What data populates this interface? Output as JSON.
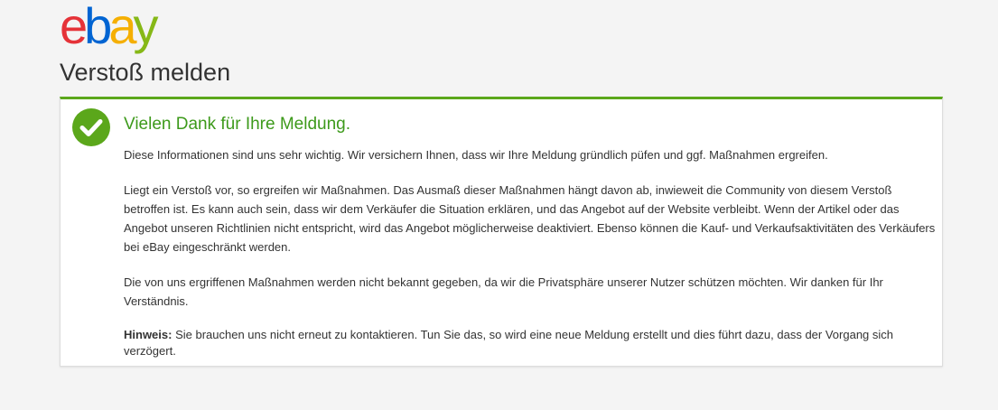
{
  "brand": {
    "logo_letters": [
      "e",
      "b",
      "a",
      "y"
    ],
    "logo_colors": [
      "#e53238",
      "#0064d2",
      "#f5af02",
      "#86b817"
    ]
  },
  "page": {
    "title": "Verstoß melden"
  },
  "confirmation": {
    "icon": "check-circle-icon",
    "accent_color": "#5ba71b",
    "heading": "Vielen Dank für Ihre Meldung.",
    "paragraph_1": "Diese Informationen sind uns sehr wichtig. Wir versichern Ihnen, dass wir Ihre Meldung gründlich püfen und ggf. Maßnahmen ergreifen.",
    "paragraph_2": "Liegt ein Verstoß vor, so ergreifen wir Maßnahmen. Das Ausmaß dieser Maßnahmen hängt davon ab, inwieweit die Community von diesem Verstoß betroffen ist. Es kann auch sein, dass wir dem Verkäufer die Situation erklären, und das Angebot auf der Website verbleibt. Wenn der Artikel oder das Angebot unseren Richtlinien nicht entspricht, wird das Angebot möglicherweise deaktiviert. Ebenso können die Kauf- und Verkaufsaktivitäten des Verkäufers bei eBay eingeschränkt werden.",
    "paragraph_3": "Die von uns ergriffenen Maßnahmen werden nicht bekannt gegeben, da wir die Privatsphäre unserer Nutzer schützen möchten. Wir danken für Ihr Verständnis.",
    "note_label": "Hinweis:",
    "note_text": " Sie brauchen uns nicht erneut zu kontaktieren. Tun Sie das, so wird eine neue Meldung erstellt und dies führt dazu, dass der Vorgang sich verzögert."
  }
}
